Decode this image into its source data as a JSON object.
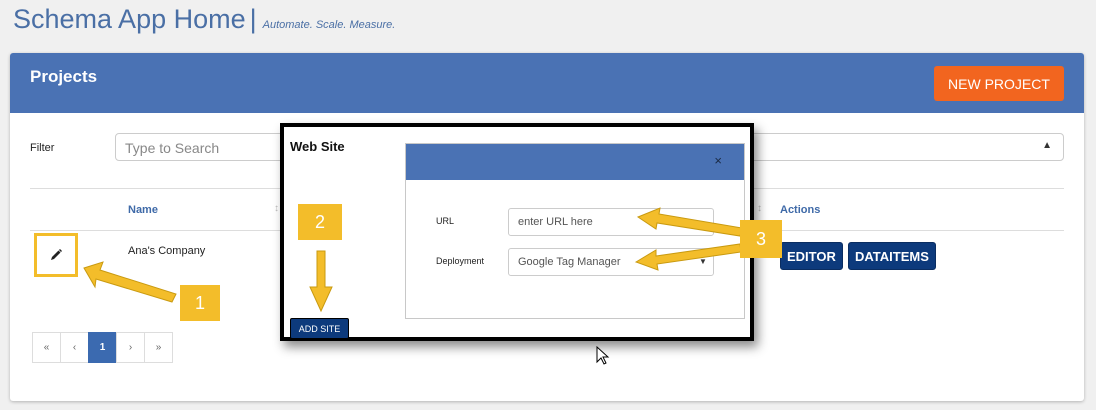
{
  "header": {
    "app_title": "Schema App Home",
    "separator": "|",
    "tagline": "Automate. Scale. Measure."
  },
  "projects": {
    "title": "Projects",
    "new_project_label": "NEW PROJECT",
    "filter_label": "Filter",
    "filter_placeholder": "Type to Search",
    "columns": {
      "name": "Name",
      "actions": "Actions"
    },
    "rows": [
      {
        "name": "Ana's Company",
        "editor_label": "EDITOR",
        "dataitems_label": "DATAITEMS"
      }
    ],
    "pagination": {
      "first": "«",
      "prev": "‹",
      "current": "1",
      "next": "›",
      "last": "»"
    }
  },
  "website_modal": {
    "title": "Web Site",
    "add_site_label": "ADD SITE",
    "close_glyph": "×",
    "url_label": "URL",
    "url_placeholder": "enter URL here",
    "deployment_label": "Deployment",
    "deployment_value": "Google Tag Manager"
  },
  "callouts": {
    "one": "1",
    "two": "2",
    "three": "3"
  },
  "colors": {
    "brand_blue": "#4a72b4",
    "navy_button": "#0d3a7c",
    "orange": "#f2651f",
    "callout_yellow": "#f3bd2a"
  }
}
